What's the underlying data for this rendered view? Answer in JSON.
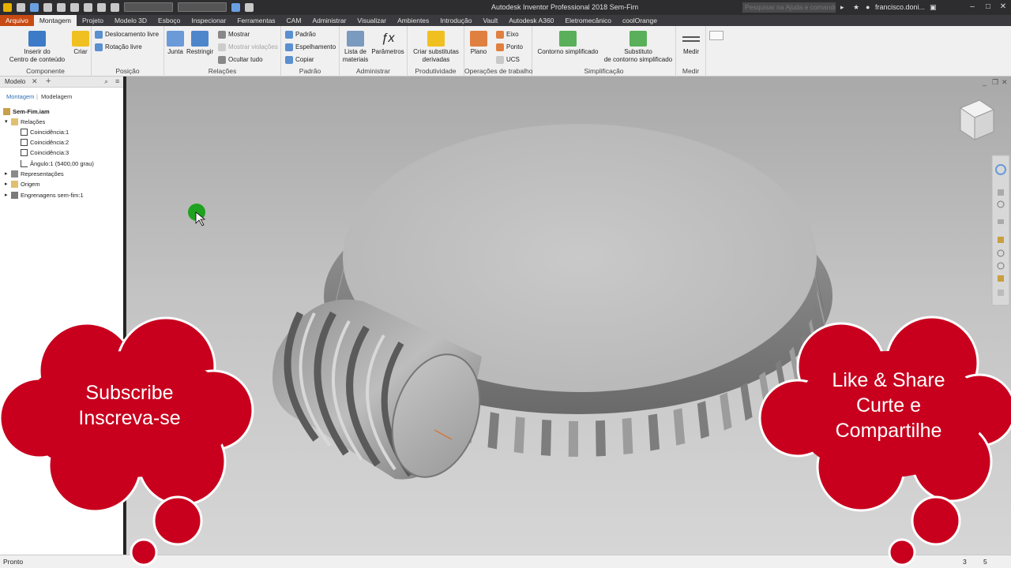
{
  "window": {
    "title": "Autodesk Inventor Professional 2018   Sem-Fim",
    "help_search_placeholder": "Pesquisar na Ajuda e comandos",
    "user": "francisco.doni..."
  },
  "tabs": [
    "Arquivo",
    "Montagem",
    "Projeto",
    "Modelo 3D",
    "Esboço",
    "Inspecionar",
    "Ferramentas",
    "CAM",
    "Administrar",
    "Visualizar",
    "Ambientes",
    "Introdução",
    "Vault",
    "Autodesk A360",
    "Eletromecânico",
    "coolOrange"
  ],
  "ribbon": {
    "componente": {
      "title": "Componente",
      "inserir": "Inserir do\nCentro de conteúdo",
      "criar": "Criar"
    },
    "posicao": {
      "title": "Posição",
      "deslocamento": "Deslocamento livre",
      "rotacao": "Rotação livre"
    },
    "relacoes": {
      "title": "Relações",
      "junta": "Junta",
      "restringir": "Restringir",
      "mostrar": "Mostrar",
      "mostrar_violacoes": "Mostrar violações",
      "ocultar_tudo": "Ocultar tudo"
    },
    "padrao": {
      "title": "Padrão",
      "padrao": "Padrão",
      "espelhamento": "Espelhamento",
      "copiar": "Copiar"
    },
    "administrar": {
      "title": "Administrar",
      "lista": "Lista de\nmateriais",
      "parametros": "Parâmetros"
    },
    "produtividade": {
      "title": "Produtividade",
      "criar_subst": "Criar substitutas\nderivadas"
    },
    "operacoes": {
      "title": "Operações de trabalho",
      "plano": "Plano",
      "eixo": "Eixo",
      "ponto": "Ponto",
      "ucs": "UCS"
    },
    "simplificacao": {
      "title": "Simplificação",
      "contorno": "Contorno simplificado",
      "substituto": "Substituto\nde contorno simplificado"
    },
    "medir": {
      "title": "Medir",
      "medir": "Medir"
    }
  },
  "browser": {
    "tab": "Modelo",
    "sub_montagem": "Montagem",
    "sub_modelagem": "Modelagem",
    "tree": [
      {
        "label": "Sem-Fim.iam",
        "level": 0,
        "bold": true
      },
      {
        "label": "Relações",
        "level": 1
      },
      {
        "label": "Coincidência:1",
        "level": 2
      },
      {
        "label": "Coincidência:2",
        "level": 2
      },
      {
        "label": "Coincidência:3",
        "level": 2
      },
      {
        "label": "Ângulo:1 (5400,00 grau)",
        "level": 2
      },
      {
        "label": "Representações",
        "level": 1
      },
      {
        "label": "Origem",
        "level": 1
      },
      {
        "label": "Engrenagens sem-fim:1",
        "level": 1
      }
    ]
  },
  "overlay": {
    "left_cloud": "Subscribe\nInscreva-se",
    "right_cloud": "Like & Share\nCurte e\nCompartilhe",
    "cloud_color": "#c8001e"
  },
  "status": {
    "text": "Pronto",
    "n1": "3",
    "n2": "5"
  }
}
